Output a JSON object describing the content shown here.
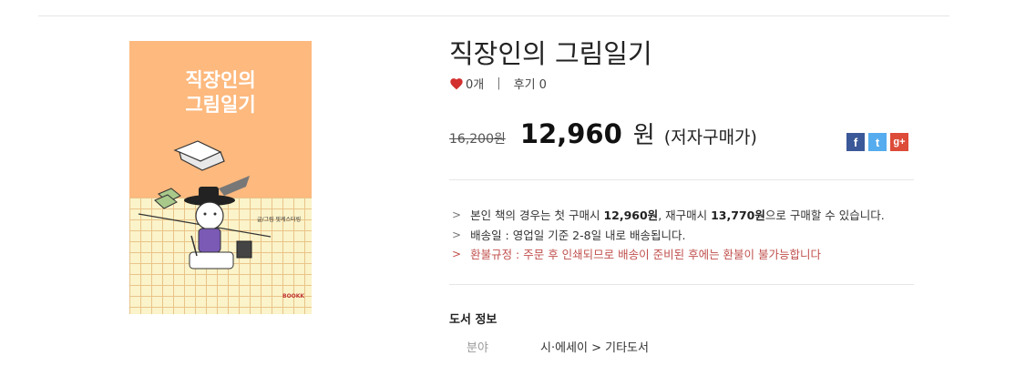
{
  "book": {
    "title": "직장인의 그림일기",
    "cover_title_line1": "직장인의",
    "cover_title_line2": "그림일기",
    "cover_author": "글/그림 핏케스터링",
    "cover_publisher": "BOOKK"
  },
  "meta": {
    "likes": "0개",
    "separator": "|",
    "reviews": "후기 0"
  },
  "price": {
    "original": "16,200원",
    "sale": "12,960",
    "currency": "원",
    "note": "(저자구매가)"
  },
  "share": {
    "facebook": "f",
    "twitter": "t",
    "googleplus": "g+"
  },
  "info": {
    "chevron": ">",
    "line1_a": "본인 책의 경우는 첫 구매시 ",
    "line1_b": "12,960원",
    "line1_c": ", 재구매시 ",
    "line1_d": "13,770원",
    "line1_e": "으로 구매할 수 있습니다.",
    "line2": "배송일 : 영업일 기준 2-8일 내로 배송됩니다.",
    "line3": "환불규정 : 주문 후 인쇄되므로 배송이 준비된 후에는 환불이 불가능합니다"
  },
  "details": {
    "section_title": "도서 정보",
    "rows": [
      {
        "label": "분야",
        "value": "시·에세이 > 기타도서"
      }
    ]
  },
  "colors": {
    "cover_bg": "#fdb97e",
    "heart": "#d32f2f",
    "refund_text": "#c0504d"
  }
}
